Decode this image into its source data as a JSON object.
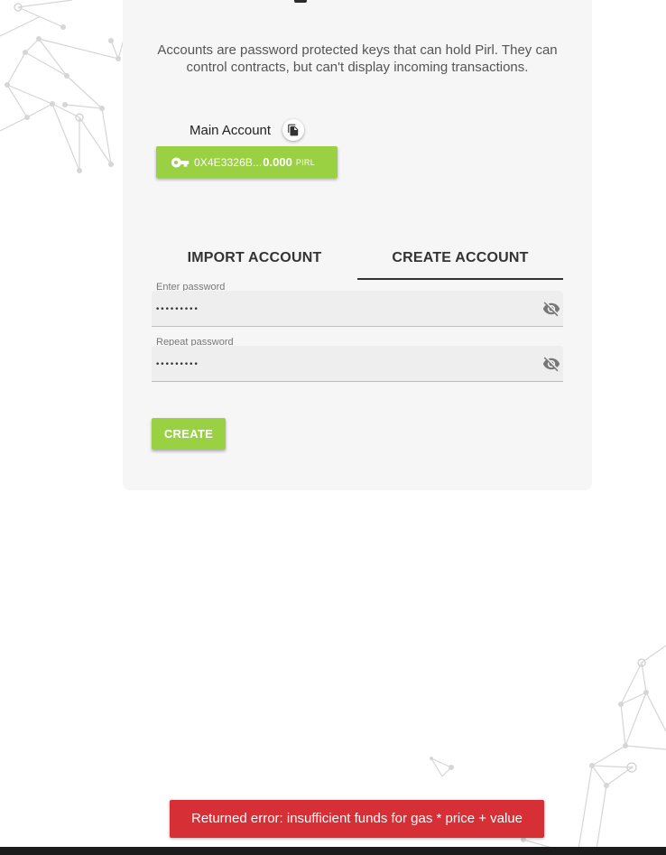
{
  "intro": "Accounts are password protected keys that can hold Pirl. They can control contracts, but can't display incoming transactions.",
  "account": {
    "label": "Main Account",
    "address": "0X4E3326B...",
    "balance": "0.000",
    "unit": "PIRL",
    "icon": "key-icon",
    "copy_icon": "copy-icon"
  },
  "tabs": [
    {
      "label": "IMPORT ACCOUNT",
      "active": false
    },
    {
      "label": "CREATE ACCOUNT",
      "active": true
    }
  ],
  "fields": {
    "password": {
      "label": "Enter password",
      "value": "•••••••••"
    },
    "repeat": {
      "label": "Repeat password",
      "value": "•••••••••"
    }
  },
  "create_label": "CREATE",
  "toast": "Returned error: insufficient funds for gas * price + value",
  "colors": {
    "accent_green": "#9ad142",
    "error_red": "#d62f35",
    "card_bg": "#f6f6f6"
  }
}
